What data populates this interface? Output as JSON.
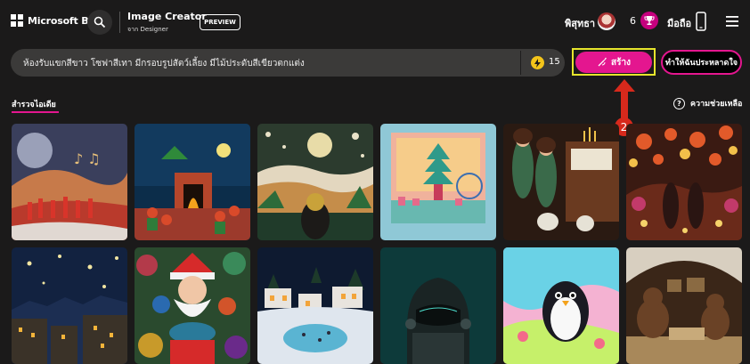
{
  "brand": {
    "name": "Microsoft Bing"
  },
  "header": {
    "title": "Image Creator",
    "subtitle": "จาก Designer",
    "badge": "PREVIEW",
    "user_name": "พิสุทธา",
    "boost_count": "6",
    "mobile_label": "มือถือ"
  },
  "prompt": {
    "text": "ห้องรับแขกสีขาว โซฟาสีเทา มีกรอบรูปสัตว์เลี้ยง มีไม้ประดับสีเขียวตกแต่ง",
    "coin_count": "15"
  },
  "buttons": {
    "create_label": "สร้าง",
    "surprise_label": "ทำให้ฉันประหลาดใจ"
  },
  "annotation": {
    "step": "2"
  },
  "tabs": {
    "explore": "สำรวจไอเดีย"
  },
  "help": {
    "label": "ความช่วยเหลือ"
  },
  "colors": {
    "accent": "#e4168f",
    "highlight": "#e6e52c",
    "annotation_red": "#d7291c",
    "background": "#1b1a1a"
  },
  "icons": [
    "search-icon",
    "trophy-icon",
    "phone-icon",
    "menu-icon",
    "coin-icon",
    "wand-icon",
    "help-icon"
  ]
}
